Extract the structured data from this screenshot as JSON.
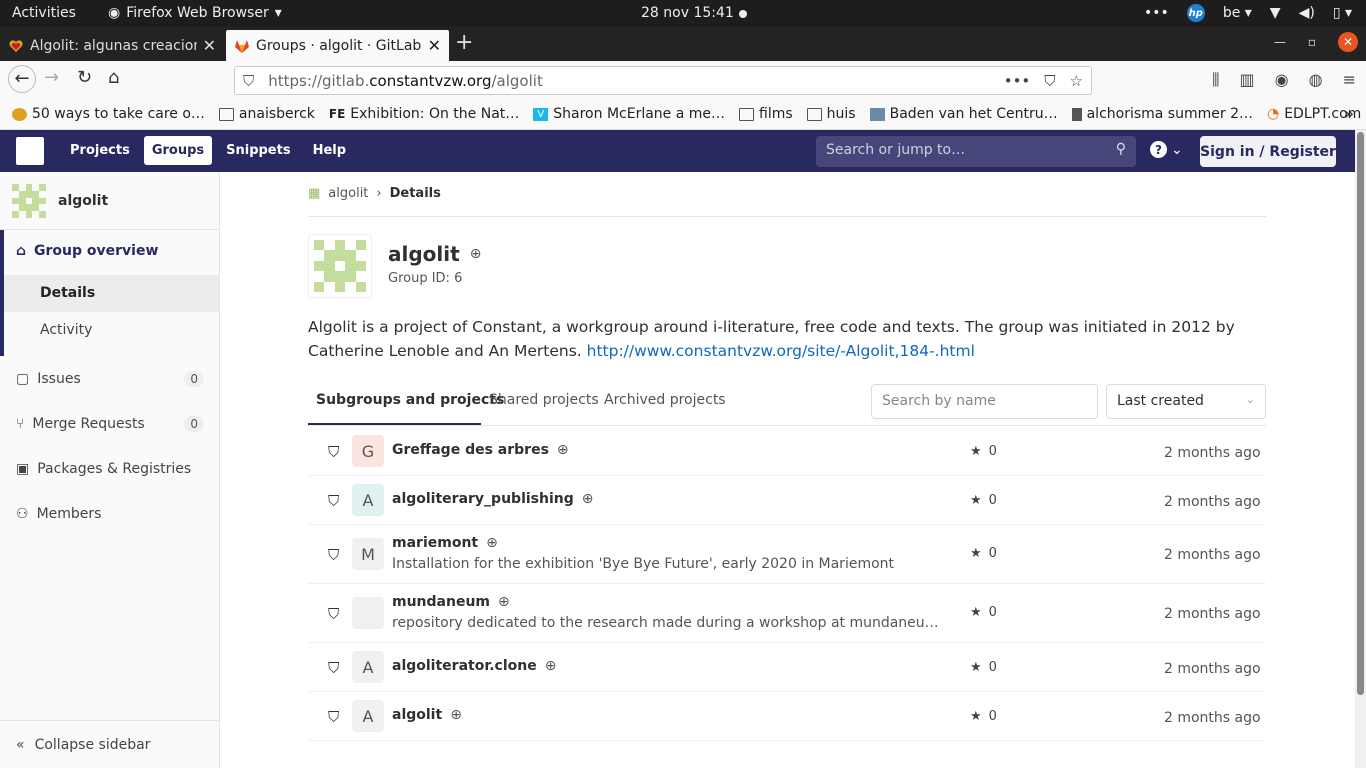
{
  "system": {
    "activities": "Activities",
    "app": "Firefox Web Browser",
    "clock": "28 nov  15:41",
    "keyboard": "be"
  },
  "browser": {
    "tabs": [
      {
        "title": "Algolit: algunas creacion"
      },
      {
        "title": "Groups · algolit · GitLab"
      }
    ],
    "url_prefix": "https://gitlab.",
    "url_host": "constantvzw.org",
    "url_path": "/algolit",
    "bookmarks": [
      {
        "label": "50 ways to take care o…",
        "icon": "heart-icon"
      },
      {
        "label": "anaisberck",
        "icon": "folder-icon"
      },
      {
        "label": "Exhibition: On the Nat…",
        "icon": "fe-icon"
      },
      {
        "label": "Sharon McErlane a me…",
        "icon": "vimeo-icon"
      },
      {
        "label": "films",
        "icon": "folder-icon"
      },
      {
        "label": "huis",
        "icon": "folder-icon"
      },
      {
        "label": "Baden van het Centru…",
        "icon": "image-icon"
      },
      {
        "label": "alchorisma summer 2…",
        "icon": "book-icon"
      },
      {
        "label": "EDLPT.com",
        "icon": "edlpt-icon"
      }
    ]
  },
  "gitlab": {
    "nav": [
      "Projects",
      "Groups",
      "Snippets",
      "Help"
    ],
    "search_placeholder": "Search or jump to…",
    "signin": "Sign in / Register",
    "brand_color": "#292961"
  },
  "sidebar": {
    "group_name": "algolit",
    "overview": "Group overview",
    "details": "Details",
    "activity": "Activity",
    "issues": {
      "label": "Issues",
      "count": "0"
    },
    "merge_requests": {
      "label": "Merge Requests",
      "count": "0"
    },
    "packages": "Packages & Registries",
    "members": "Members",
    "collapse": "Collapse sidebar"
  },
  "main": {
    "breadcrumb": {
      "group": "algolit",
      "current": "Details"
    },
    "group_name": "algolit",
    "group_id": "Group ID: 6",
    "description": "Algolit is a project of Constant, a workgroup around i-literature, free code and texts. The group was initiated in 2012 by Catherine Lenoble and An Mertens. ",
    "description_link": "http://www.constantvzw.org/site/-Algolit,184-.html",
    "tabs": [
      "Subgroups and projects",
      "Shared projects",
      "Archived projects"
    ],
    "search_placeholder": "Search by name",
    "sort": "Last created",
    "projects": [
      {
        "letter": "G",
        "name": "Greffage des arbres",
        "desc": "",
        "stars": "0",
        "updated": "2 months ago"
      },
      {
        "letter": "A",
        "name": "algoliterary_publishing",
        "desc": "",
        "stars": "0",
        "updated": "2 months ago"
      },
      {
        "letter": "M",
        "name": "mariemont",
        "desc": "Installation for the exhibition 'Bye Bye Future', early 2020 in Mariemont",
        "stars": "0",
        "updated": "2 months ago"
      },
      {
        "letter": "",
        "name": "mundaneum",
        "desc": "repository dedicated to the research made during a workshop at mundaneum (mons,…",
        "stars": "0",
        "updated": "2 months ago"
      },
      {
        "letter": "A",
        "name": "algoliterator.clone",
        "desc": "",
        "stars": "0",
        "updated": "2 months ago"
      },
      {
        "letter": "A",
        "name": "algolit",
        "desc": "",
        "stars": "0",
        "updated": "2 months ago"
      }
    ]
  }
}
